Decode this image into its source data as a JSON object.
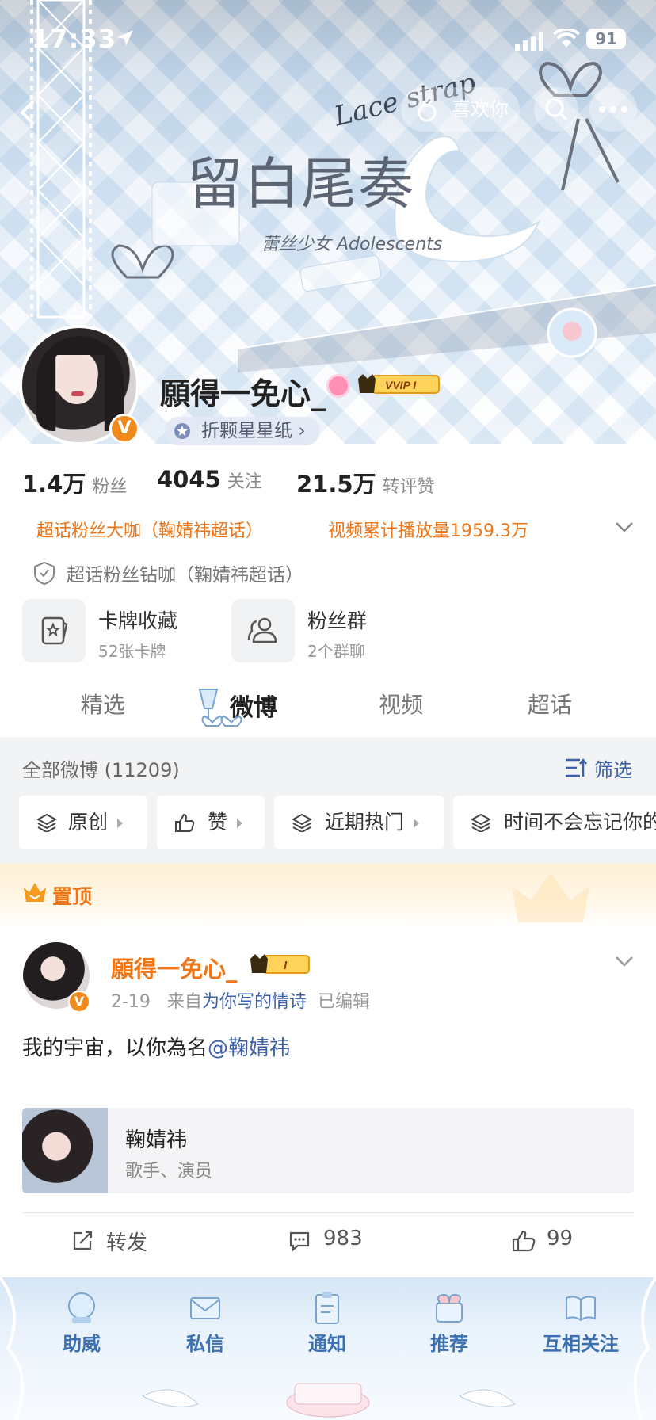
{
  "status_bar": {
    "time": "17:33",
    "battery": "91"
  },
  "header": {
    "like_label": "喜欢你",
    "banner_title": "留白尾奏",
    "banner_subtitle": "蕾丝少女 Adolescents",
    "banner_lace_text": "Lace strap"
  },
  "profile": {
    "name": "願得一免心_",
    "vip_label": "VVIP I",
    "star_paper_label": "折颗星星纸",
    "verified": "V",
    "stats": [
      {
        "value": "1.4万",
        "label": "粉丝"
      },
      {
        "value": "4045",
        "label": "关注"
      },
      {
        "value": "21.5万",
        "label": "转评赞"
      }
    ],
    "tags": [
      "超话粉丝大咖（鞠婧祎超话）",
      "视频累计播放量1959.3万"
    ],
    "diamond_tag": "超话粉丝钻咖（鞠婧祎超话）",
    "shortcuts": [
      {
        "title": "卡牌收藏",
        "subtitle": "52张卡牌",
        "icon": "card-icon"
      },
      {
        "title": "粉丝群",
        "subtitle": "2个群聊",
        "icon": "group-icon"
      }
    ]
  },
  "tabs": [
    "精选",
    "微博",
    "视频",
    "超话"
  ],
  "active_tab": "微博",
  "feed": {
    "count_label": "全部微博 (11209)",
    "filter_label": "筛选",
    "chips": [
      "原创",
      "赞",
      "近期热门",
      "时间不会忘记你的"
    ]
  },
  "pinned_label": "置顶",
  "post": {
    "author": "願得一免心_",
    "vip_label": "I",
    "date": "2-19",
    "from_prefix": "来自",
    "source": "为你写的情诗",
    "edited": "已编辑",
    "text": "我的宇宙，以你為名",
    "mention": "@鞠婧祎",
    "card_title": "鞠婧祎",
    "card_subtitle": "歌手、演员",
    "repost_label": "转发",
    "comment_count": "983",
    "like_count": "99"
  },
  "bottom_bar": [
    "助威",
    "私信",
    "通知",
    "推荐",
    "互相关注"
  ],
  "colors": {
    "accent_orange": "#f07516",
    "link_blue": "#3c60a8",
    "bottom_blue": "#3b6fb0"
  }
}
